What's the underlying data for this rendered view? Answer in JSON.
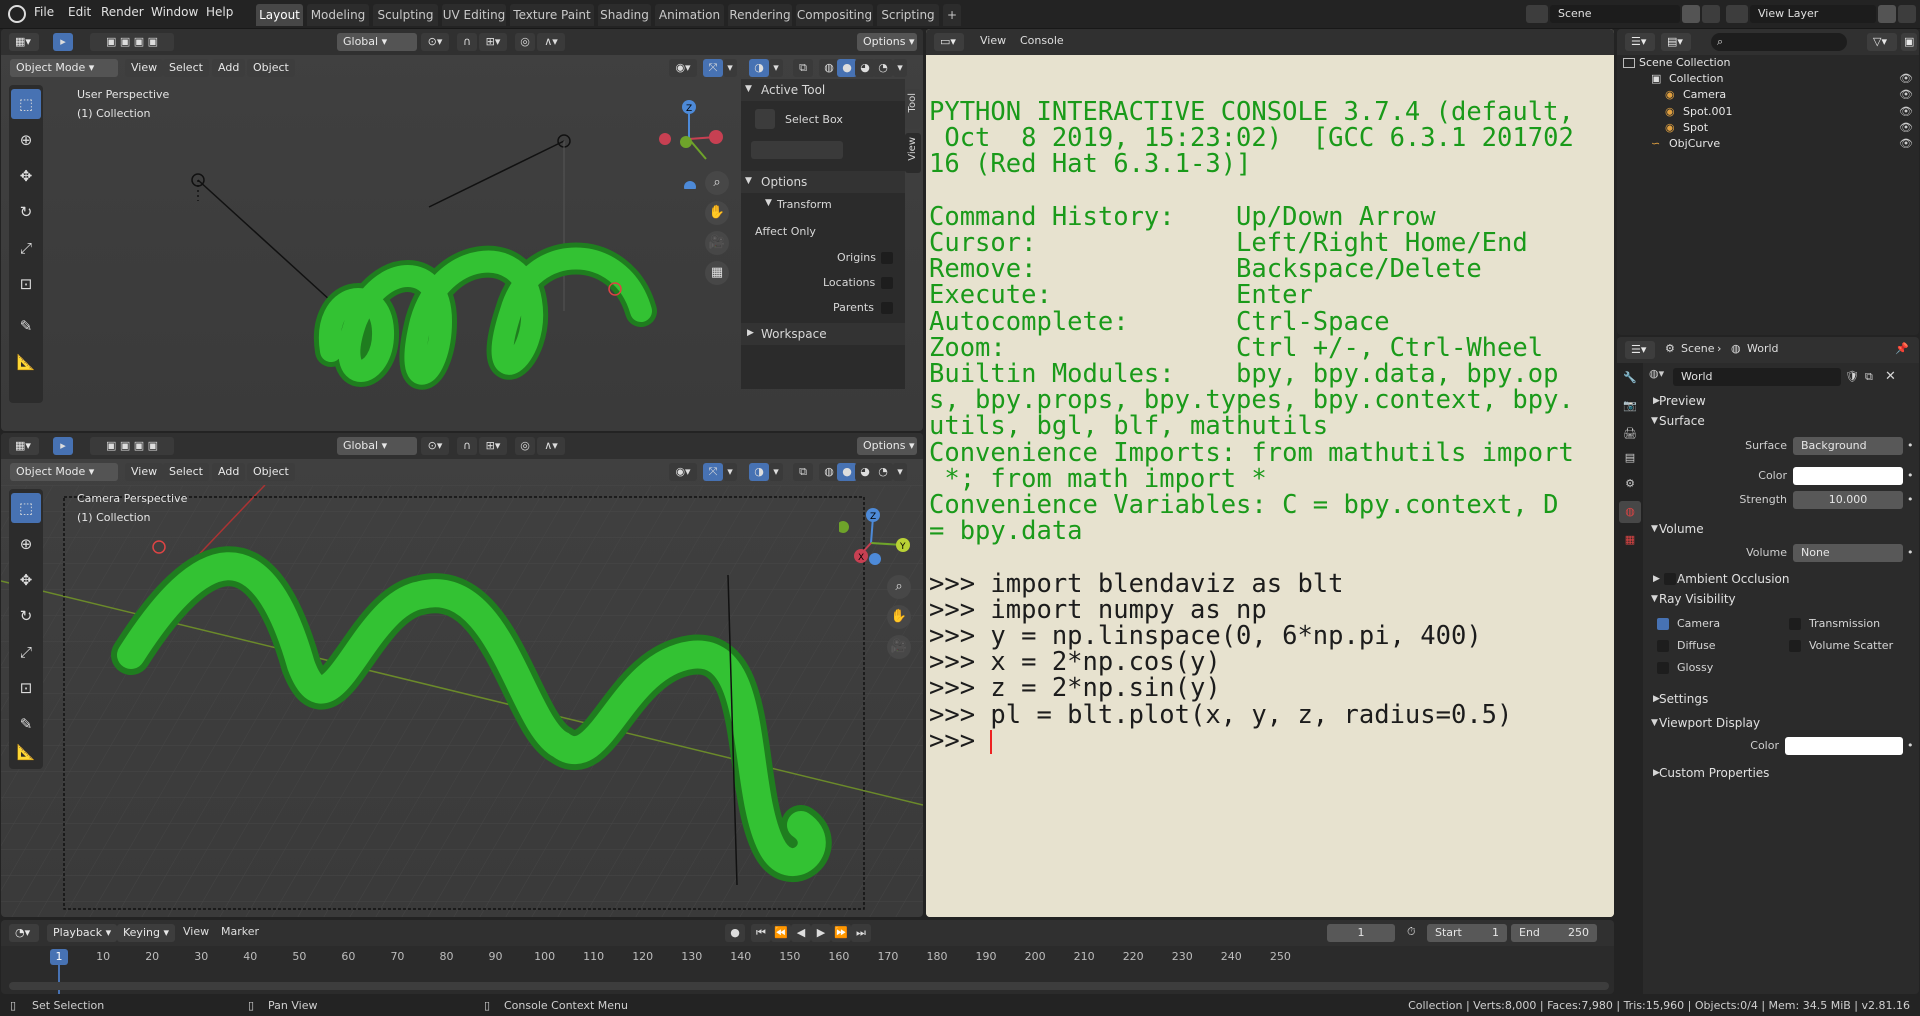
{
  "topbar": {
    "menus": [
      "File",
      "Edit",
      "Render",
      "Window",
      "Help"
    ],
    "workspaces": [
      "Layout",
      "Modeling",
      "Sculpting",
      "UV Editing",
      "Texture Paint",
      "Shading",
      "Animation",
      "Rendering",
      "Compositing",
      "Scripting"
    ],
    "active_workspace": "Layout",
    "add_tab": "+",
    "scene": "Scene",
    "view_layer": "View Layer"
  },
  "viewport_top": {
    "mode": "Object Mode",
    "menus": [
      "View",
      "Select",
      "Add",
      "Object"
    ],
    "orientation": "Global",
    "options": "Options",
    "perspective": "User Perspective",
    "collection": "(1) Collection"
  },
  "sidebar": {
    "tabs": [
      "Tool",
      "View"
    ],
    "active_tool_header": "Active Tool",
    "active_tool": "Select Box",
    "options_header": "Options",
    "transform_header": "Transform",
    "affect_only": "Affect Only",
    "origins": "Origins",
    "locations": "Locations",
    "parents": "Parents",
    "workspace_header": "Workspace"
  },
  "viewport_bottom": {
    "mode": "Object Mode",
    "menus": [
      "View",
      "Select",
      "Add",
      "Object"
    ],
    "orientation": "Global",
    "options": "Options",
    "perspective": "Camera Perspective",
    "collection": "(1) Collection"
  },
  "console": {
    "menus": [
      "View",
      "Console"
    ],
    "lines": [
      {
        "t": "PYTHON INTERACTIVE CONSOLE 3.7.4 (default,",
        "c": "out"
      },
      {
        "t": " Oct  8 2019, 15:23:02)  [GCC 6.3.1 201702",
        "c": "out"
      },
      {
        "t": "16 (Red Hat 6.3.1-3)]",
        "c": "out"
      },
      {
        "t": "",
        "c": "out"
      },
      {
        "t": "Command History:    Up/Down Arrow",
        "c": "out"
      },
      {
        "t": "Cursor:             Left/Right Home/End",
        "c": "out"
      },
      {
        "t": "Remove:             Backspace/Delete",
        "c": "out"
      },
      {
        "t": "Execute:            Enter",
        "c": "out"
      },
      {
        "t": "Autocomplete:       Ctrl-Space",
        "c": "out"
      },
      {
        "t": "Zoom:               Ctrl +/-, Ctrl-Wheel",
        "c": "out"
      },
      {
        "t": "Builtin Modules:    bpy, bpy.data, bpy.op",
        "c": "out"
      },
      {
        "t": "s, bpy.props, bpy.types, bpy.context, bpy.",
        "c": "out"
      },
      {
        "t": "utils, bgl, blf, mathutils",
        "c": "out"
      },
      {
        "t": "Convenience Imports: from mathutils import",
        "c": "out"
      },
      {
        "t": " *; from math import *",
        "c": "out"
      },
      {
        "t": "Convenience Variables: C = bpy.context, D",
        "c": "out"
      },
      {
        "t": "= bpy.data",
        "c": "out"
      },
      {
        "t": "",
        "c": "out"
      },
      {
        "t": ">>> import blendaviz as blt",
        "c": "cmd"
      },
      {
        "t": ">>> import numpy as np",
        "c": "cmd"
      },
      {
        "t": ">>> y = np.linspace(0, 6*np.pi, 400)",
        "c": "cmd"
      },
      {
        "t": ">>> x = 2*np.cos(y)",
        "c": "cmd"
      },
      {
        "t": ">>> z = 2*np.sin(y)",
        "c": "cmd"
      },
      {
        "t": ">>> pl = blt.plot(x, y, z, radius=0.5)",
        "c": "cmd"
      }
    ],
    "prompt": ">>> "
  },
  "outliner": {
    "root": "Scene Collection",
    "items": [
      {
        "label": "Collection",
        "indent": 1
      },
      {
        "label": "Camera",
        "indent": 2
      },
      {
        "label": "Spot.001",
        "indent": 2
      },
      {
        "label": "Spot",
        "indent": 2
      },
      {
        "label": "ObjCurve",
        "indent": 1
      }
    ]
  },
  "properties": {
    "breadcrumb_scene": "Scene",
    "breadcrumb_world": "World",
    "world_name": "World",
    "preview": "Preview",
    "surface": "Surface",
    "surface_label": "Surface",
    "surface_value": "Background",
    "color_label": "Color",
    "strength_label": "Strength",
    "strength_value": "10.000",
    "volume_header": "Volume",
    "volume_label": "Volume",
    "volume_value": "None",
    "ambient_occlusion": "Ambient Occlusion",
    "ray_visibility": "Ray Visibility",
    "camera": "Camera",
    "transmission": "Transmission",
    "diffuse": "Diffuse",
    "volume_scatter": "Volume Scatter",
    "glossy": "Glossy",
    "settings": "Settings",
    "viewport_display": "Viewport Display",
    "vd_color": "Color",
    "custom_properties": "Custom Properties"
  },
  "timeline": {
    "menus": [
      "Playback",
      "Keying",
      "View",
      "Marker"
    ],
    "current_frame": "1",
    "start_label": "Start",
    "start": "1",
    "end_label": "End",
    "end": "250",
    "ticks": [
      "1",
      "10",
      "20",
      "30",
      "40",
      "50",
      "60",
      "70",
      "80",
      "90",
      "100",
      "110",
      "120",
      "130",
      "140",
      "150",
      "160",
      "170",
      "180",
      "190",
      "200",
      "210",
      "220",
      "230",
      "240",
      "250"
    ]
  },
  "status": {
    "left1": "Set Selection",
    "left2": "Pan View",
    "left3": "Console Context Menu",
    "stats": "Collection | Verts:8,000 | Faces:7,980 | Tris:15,960 | Objects:0/4 | Mem: 34.5 MiB | v2.81.16"
  },
  "colors": {
    "accent": "#4772b3",
    "console_bg": "#e7e2cf",
    "console_text": "#1a9a1a",
    "curve": "#22b022"
  }
}
